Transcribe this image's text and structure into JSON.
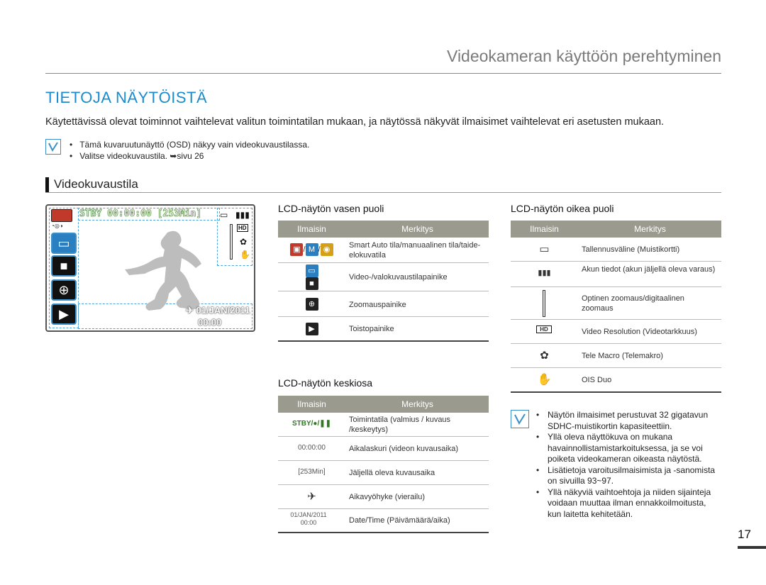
{
  "header": {
    "title": "Videokameran käyttöön perehtyminen"
  },
  "section": {
    "title": "TIETOJA NÄYTÖISTÄ",
    "intro": "Käytettävissä olevat toiminnot vaihtelevat valitun toimintatilan mukaan, ja näytössä näkyvät ilmaisimet vaihtelevat eri asetusten mukaan."
  },
  "notes": [
    "Tämä kuvaruutunäyttö (OSD) näkyy vain videokuvaustilassa.",
    "Valitse videokuvaustila. ➥sivu 26"
  ],
  "subsection": {
    "title": "Videokuvaustila"
  },
  "lcd": {
    "stby": "STBY",
    "counter": "00:00:00",
    "remaining": "[253Min]",
    "date": "01/JAN/2011",
    "time": "00:00"
  },
  "left_table": {
    "title": "LCD-näytön vasen puoli",
    "headers": [
      "Ilmaisin",
      "Merkitys"
    ],
    "rows": [
      {
        "icon": "smart-auto-icons",
        "text": "Smart Auto  tila/manuaalinen tila/taide-elokuvatila"
      },
      {
        "icon": "video-photo-mode-icons",
        "text": "Video-/valokuvaustilapainike"
      },
      {
        "icon": "zoom-button-icon",
        "text": "Zoomauspainike"
      },
      {
        "icon": "playback-button-icon",
        "text": "Toistopainike"
      }
    ]
  },
  "center_table": {
    "title": "LCD-näytön keskiosa",
    "headers": [
      "Ilmaisin",
      "Merkitys"
    ],
    "rows": [
      {
        "indicator": "STBY/●/❚❚",
        "text": "Toimintatila (valmius / kuvaus /keskeytys)"
      },
      {
        "indicator": "00:00:00",
        "text": "Aikalaskuri (videon kuvausaika)"
      },
      {
        "indicator": "[253Min]",
        "text": "Jäljellä oleva kuvausaika"
      },
      {
        "indicator": "✈",
        "text": "Aikavyöhyke (vierailu)"
      },
      {
        "indicator": "01/JAN/2011 00:00",
        "text": "Date/Time (Päivämäärä/aika)"
      }
    ]
  },
  "right_table": {
    "title": "LCD-näytön oikea puoli",
    "headers": [
      "Ilmaisin",
      "Merkitys"
    ],
    "rows": [
      {
        "icon": "memory-card-icon",
        "text": "Tallennusväline (Muistikortti)"
      },
      {
        "icon": "battery-icon",
        "text": "Akun tiedot (akun jäljellä oleva varaus)"
      },
      {
        "icon": "zoom-bar-icon",
        "text": "Optinen zoomaus/digitaalinen zoomaus"
      },
      {
        "icon": "full-hd-icon",
        "text": "Video Resolution (Videotarkkuus)"
      },
      {
        "icon": "tele-macro-icon",
        "text": "Tele Macro (Telemakro)"
      },
      {
        "icon": "ois-duo-icon",
        "text": "OIS Duo"
      }
    ]
  },
  "notes2": [
    "Näytön ilmaisimet perustuvat 32 gigatavun SDHC-muistikortin kapasiteettiin.",
    "Yllä oleva näyttökuva on mukana havainnollistamistarkoituksessa, ja se voi poiketa videokameran oikeasta näytöstä.",
    "Lisätietoja varoitusilmaisimista ja -sanomista on sivuilla 93~97.",
    "Yllä näkyviä vaihtoehtoja ja niiden sijainteja voidaan muuttaa ilman ennakkoilmoitusta, kun laitetta kehitetään."
  ],
  "page": {
    "number": "17"
  },
  "colors": {
    "accent": "#1a8ccf",
    "table_header": "#9a9a8e"
  }
}
